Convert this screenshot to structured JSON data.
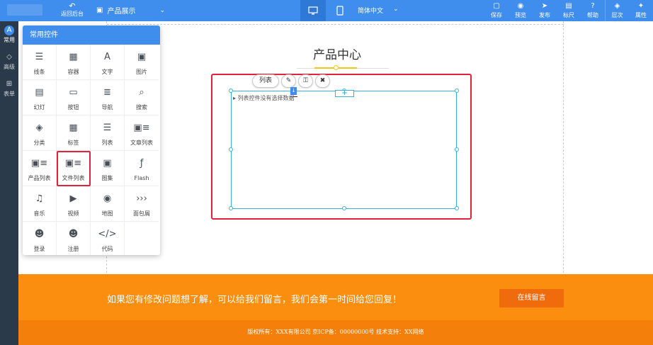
{
  "topbar": {
    "back_label": "返回后台",
    "back_icon": "undo-icon",
    "page_name": "产品展示",
    "language": "简体中文",
    "actions": [
      {
        "label": "保存",
        "icon": "save-icon"
      },
      {
        "label": "预览",
        "icon": "eye-icon"
      },
      {
        "label": "发布",
        "icon": "send-icon"
      },
      {
        "label": "标尺",
        "icon": "ruler-icon"
      },
      {
        "label": "帮助",
        "icon": "help-icon"
      },
      {
        "label": "层次",
        "icon": "layers-icon"
      },
      {
        "label": "属性",
        "icon": "magic-wand-icon"
      }
    ]
  },
  "rail": {
    "items": [
      {
        "label": "常用",
        "icon": "common-icon"
      },
      {
        "label": "高级",
        "icon": "diamond-icon"
      },
      {
        "label": "表单",
        "icon": "form-icon"
      }
    ]
  },
  "panel": {
    "title": "常用控件",
    "widgets": [
      {
        "label": "线条",
        "icon": "lines-icon",
        "glyph": "☰"
      },
      {
        "label": "容器",
        "icon": "container-icon",
        "glyph": "▦"
      },
      {
        "label": "文字",
        "icon": "text-icon",
        "glyph": "A"
      },
      {
        "label": "图片",
        "icon": "image-icon",
        "glyph": "▣"
      },
      {
        "label": "幻灯",
        "icon": "slideshow-icon",
        "glyph": "▤"
      },
      {
        "label": "按钮",
        "icon": "button-icon",
        "glyph": "▭"
      },
      {
        "label": "导航",
        "icon": "nav-icon",
        "glyph": "≣"
      },
      {
        "label": "搜索",
        "icon": "search-icon",
        "glyph": "⌕"
      },
      {
        "label": "分类",
        "icon": "category-icon",
        "glyph": "◈"
      },
      {
        "label": "标签",
        "icon": "calendar-icon",
        "glyph": "▦"
      },
      {
        "label": "列表",
        "icon": "list-icon",
        "glyph": "☰"
      },
      {
        "label": "文章列表",
        "icon": "article-list-icon",
        "glyph": "▣≡"
      },
      {
        "label": "产品列表",
        "icon": "product-list-icon",
        "glyph": "▣≡"
      },
      {
        "label": "文件列表",
        "icon": "file-list-icon",
        "glyph": "▣≡"
      },
      {
        "label": "图集",
        "icon": "gallery-icon",
        "glyph": "▣"
      },
      {
        "label": "Flash",
        "icon": "flash-icon",
        "glyph": "ƒ"
      },
      {
        "label": "音乐",
        "icon": "music-icon",
        "glyph": "♫"
      },
      {
        "label": "视频",
        "icon": "video-icon",
        "glyph": "▶"
      },
      {
        "label": "地图",
        "icon": "map-pin-icon",
        "glyph": "◉"
      },
      {
        "label": "面包屑",
        "icon": "breadcrumb-icon",
        "glyph": "›››"
      },
      {
        "label": "登录",
        "icon": "login-user-icon",
        "glyph": "☻"
      },
      {
        "label": "注册",
        "icon": "register-user-icon",
        "glyph": "☻"
      },
      {
        "label": "代码",
        "icon": "code-icon",
        "glyph": "</>"
      }
    ]
  },
  "canvas": {
    "section_title": "产品中心",
    "selected_control": {
      "name": "列表",
      "tools": [
        {
          "icon": "wrench-icon",
          "glyph": "✎"
        },
        {
          "icon": "unlock-icon",
          "glyph": "⚿"
        },
        {
          "icon": "trash-icon",
          "glyph": "🗑"
        }
      ],
      "empty_message": "列表控件没有选择数据"
    },
    "cta": {
      "text": "如果您有修改问题想了解，可以给我们留言，我们会第一时间给您回复！",
      "button": "在线留言"
    },
    "footer": "版权所有：XXX有限公司   京ICP备：00000000号   技术支持：XX网络"
  },
  "colors": {
    "primary": "#3f8ded",
    "rail": "#2b3a4a",
    "highlight": "#e0223d",
    "selection": "#3ab1d6",
    "cta_band": "#fb8e0e",
    "footer": "#f57f0b",
    "cta_button": "#f06b0b",
    "accent_gold": "#f5c518"
  }
}
